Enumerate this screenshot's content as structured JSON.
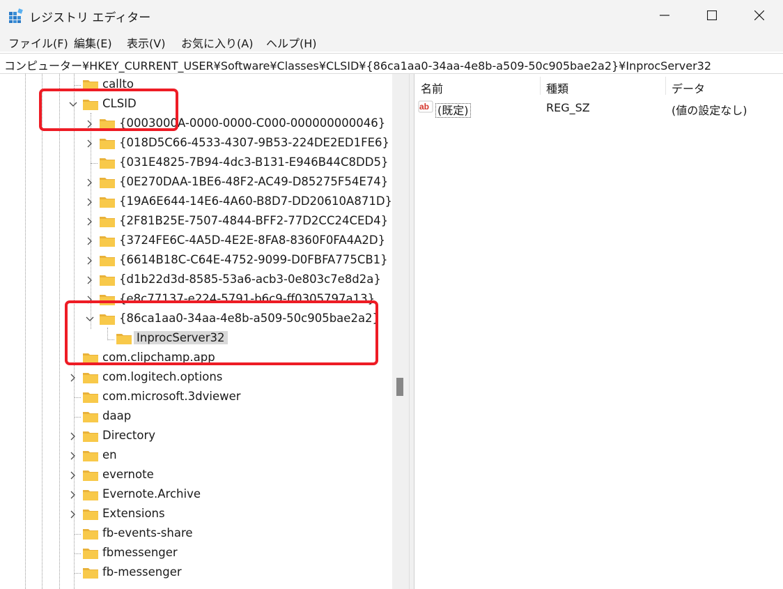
{
  "window": {
    "title": "レジストリ エディター"
  },
  "menu": [
    "ファイル(F)",
    "編集(E)",
    "表示(V)",
    "お気に入り(A)",
    "ヘルプ(H)"
  ],
  "address": "コンピューター¥HKEY_CURRENT_USER¥Software¥Classes¥CLSID¥{86ca1aa0-34aa-4e8b-a509-50c905bae2a2}¥InprocServer32",
  "tree": {
    "nodes": [
      {
        "label": "callto"
      },
      {
        "label": "CLSID"
      },
      {
        "label": "{0003000A-0000-0000-C000-000000000046}"
      },
      {
        "label": "{018D5C66-4533-4307-9B53-224DE2ED1FE6}"
      },
      {
        "label": "{031E4825-7B94-4dc3-B131-E946B44C8DD5}"
      },
      {
        "label": "{0E270DAA-1BE6-48F2-AC49-D85275F54E74}"
      },
      {
        "label": "{19A6E644-14E6-4A60-B8D7-DD20610A871D}"
      },
      {
        "label": "{2F81B25E-7507-4844-BFF2-77D2CC24CED4}"
      },
      {
        "label": "{3724FE6C-4A5D-4E2E-8FA8-8360F0FA4A2D}"
      },
      {
        "label": "{6614B18C-C64E-4752-9099-D0FBFA775CB1}"
      },
      {
        "label": "{d1b22d3d-8585-53a6-acb3-0e803c7e8d2a}"
      },
      {
        "label": "{e8c77137-e224-5791-b6c9-ff0305797a13}"
      },
      {
        "label": "{86ca1aa0-34aa-4e8b-a509-50c905bae2a2}"
      },
      {
        "label": "InprocServer32"
      },
      {
        "label": "com.clipchamp.app"
      },
      {
        "label": "com.logitech.options"
      },
      {
        "label": "com.microsoft.3dviewer"
      },
      {
        "label": "daap"
      },
      {
        "label": "Directory"
      },
      {
        "label": "en"
      },
      {
        "label": "evernote"
      },
      {
        "label": "Evernote.Archive"
      },
      {
        "label": "Extensions"
      },
      {
        "label": "fb-events-share"
      },
      {
        "label": "fbmessenger"
      },
      {
        "label": "fb-messenger"
      }
    ]
  },
  "values": {
    "columns": [
      "名前",
      "種類",
      "データ"
    ],
    "rows": [
      {
        "name": "(既定)",
        "type": "REG_SZ",
        "data": "(値の設定なし)",
        "icon": "ab-string-icon"
      }
    ]
  },
  "colors": {
    "highlight": "#ee1c25",
    "folder": "#f8c94a",
    "selection": "#d9d9d9"
  }
}
